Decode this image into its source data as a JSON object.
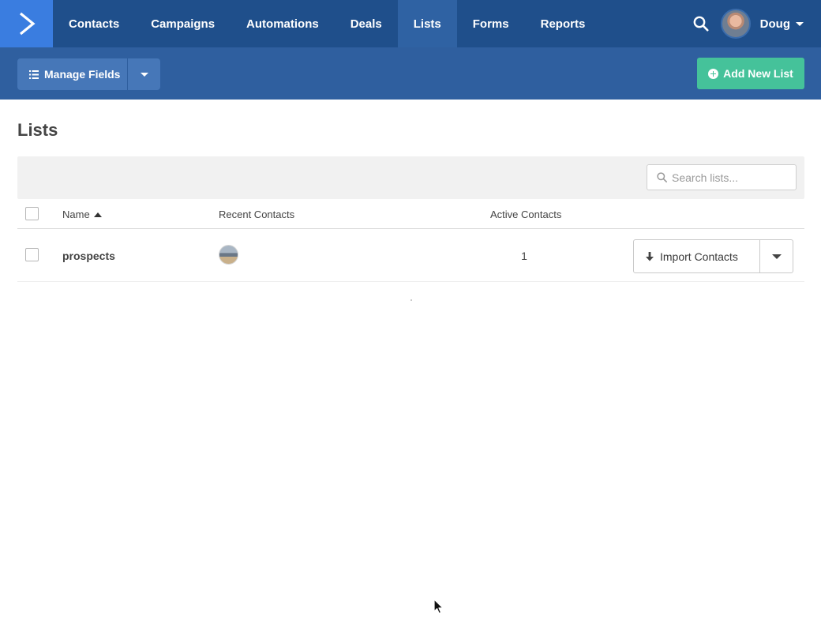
{
  "nav": {
    "items": [
      {
        "label": "Contacts",
        "active": false
      },
      {
        "label": "Campaigns",
        "active": false
      },
      {
        "label": "Automations",
        "active": false
      },
      {
        "label": "Deals",
        "active": false
      },
      {
        "label": "Lists",
        "active": true
      },
      {
        "label": "Forms",
        "active": false
      },
      {
        "label": "Reports",
        "active": false
      }
    ],
    "user_name": "Doug"
  },
  "toolbar": {
    "manage_fields_label": "Manage Fields",
    "add_new_list_label": "Add New List"
  },
  "page": {
    "title": "Lists"
  },
  "search": {
    "placeholder": "Search lists...",
    "value": ""
  },
  "table": {
    "columns": {
      "name": "Name",
      "recent_contacts": "Recent Contacts",
      "active_contacts": "Active Contacts"
    },
    "sort": {
      "column": "name",
      "direction": "ascending"
    },
    "rows": [
      {
        "name": "prospects",
        "active_contacts": "1",
        "action_label": "Import Contacts"
      }
    ]
  },
  "colors": {
    "nav_bg": "#1f4f8b",
    "nav_active": "#2f62a3",
    "logo_bg": "#3a7de0",
    "subbar_bg": "#2f5f9f",
    "button_blue": "#4677b8",
    "accent_green": "#45c29a"
  },
  "icons": {
    "logo": "chevron-right-logo-icon",
    "search": "search-icon",
    "user_caret": "caret-down-icon",
    "manage_fields": "list-icon",
    "add_list": "plus-circle-icon",
    "sort": "sort-up-icon",
    "import": "arrow-down-icon"
  }
}
